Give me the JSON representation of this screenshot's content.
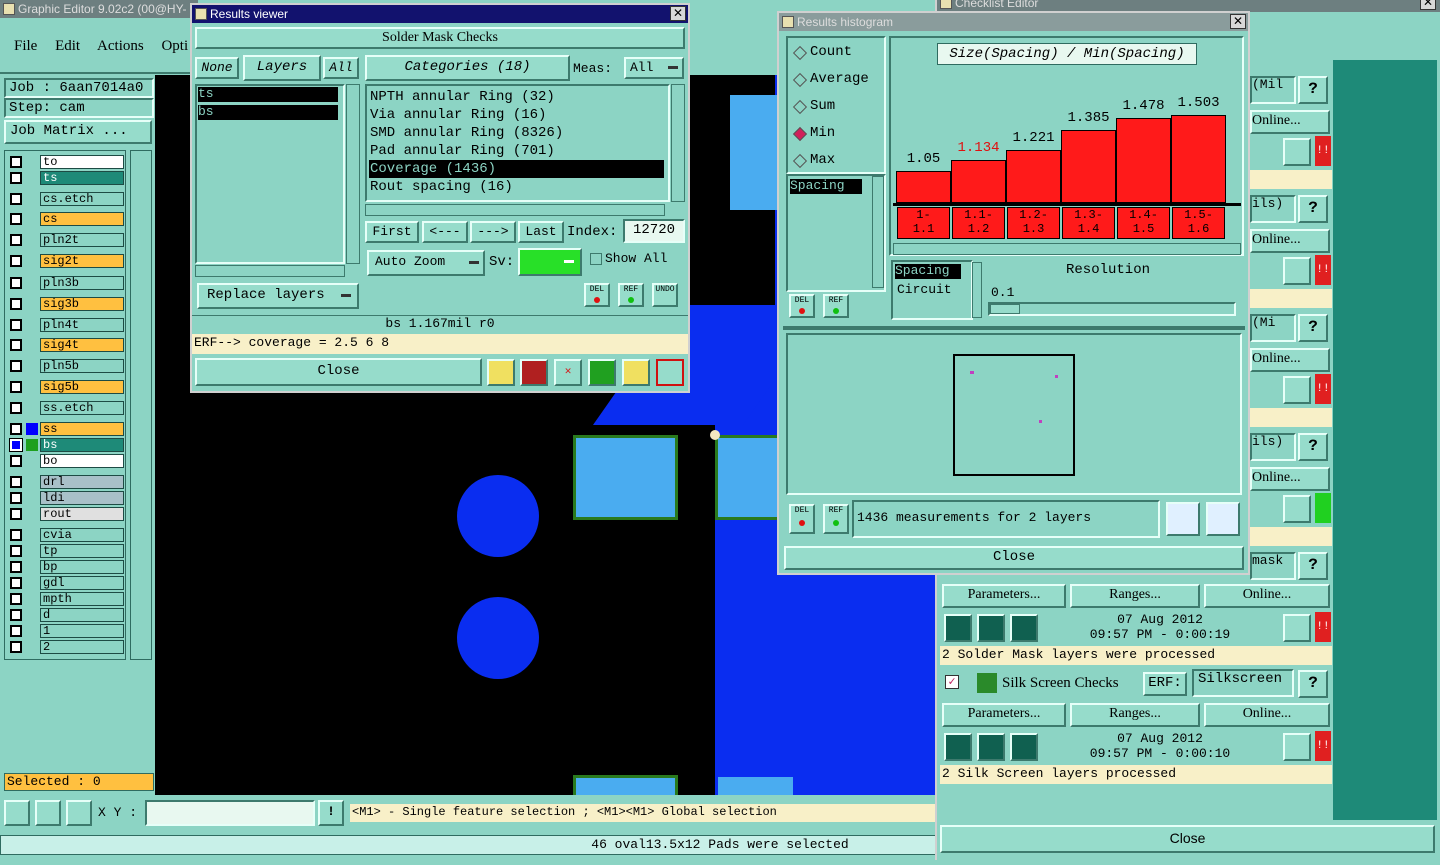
{
  "main_window": {
    "title": "Graphic Editor 9.02c2 (00@HY-",
    "menu": [
      "File",
      "Edit",
      "Actions",
      "Opti"
    ],
    "job_label": "Job : 6aan7014a0",
    "step_label": "Step: cam",
    "job_matrix": "Job Matrix ...",
    "selected": "Selected : 0",
    "xy_label": "X Y :",
    "help_text": "<M1> - Single feature selection ; <M1><M1> Global selection",
    "status": "46 oval13.5x12 Pads were selected",
    "layers": [
      {
        "name": "to",
        "color": "#ffffff"
      },
      {
        "name": "ts",
        "color": "#1e8a78"
      },
      {
        "name": "cs.etch",
        "color": "#8cd4c4"
      },
      {
        "name": "cs",
        "color": "#ffc040"
      },
      {
        "name": "pln2t",
        "color": "#8cd4c4"
      },
      {
        "name": "sig2t",
        "color": "#ffc040"
      },
      {
        "name": "pln3b",
        "color": "#8cd4c4"
      },
      {
        "name": "sig3b",
        "color": "#ffc040"
      },
      {
        "name": "pln4t",
        "color": "#8cd4c4"
      },
      {
        "name": "sig4t",
        "color": "#ffc040"
      },
      {
        "name": "pln5b",
        "color": "#8cd4c4"
      },
      {
        "name": "sig5b",
        "color": "#ffc040"
      },
      {
        "name": "ss.etch",
        "color": "#8cd4c4"
      },
      {
        "name": "ss",
        "color": "#ffc040"
      },
      {
        "name": "bs",
        "color": "#1e8a78"
      },
      {
        "name": "bo",
        "color": "#ffffff"
      },
      {
        "name": "drl",
        "color": "#a8c0c8"
      },
      {
        "name": "ldi",
        "color": "#a8c0c8"
      },
      {
        "name": "rout",
        "color": "#e0e0e0"
      },
      {
        "name": "cvia",
        "color": "#8cd4c4"
      },
      {
        "name": "tp",
        "color": "#8cd4c4"
      },
      {
        "name": "bp",
        "color": "#8cd4c4"
      },
      {
        "name": "gdl",
        "color": "#8cd4c4"
      },
      {
        "name": "mpth",
        "color": "#8cd4c4"
      },
      {
        "name": "d",
        "color": "#8cd4c4"
      },
      {
        "name": "1",
        "color": "#8cd4c4"
      },
      {
        "name": "2",
        "color": "#8cd4c4"
      }
    ]
  },
  "results_viewer": {
    "title": "Results viewer",
    "header": "Solder Mask Checks",
    "none": "None",
    "layers": "Layers",
    "all": "All",
    "categories": "Categories (18)",
    "meas_label": "Meas:",
    "meas_value": "All",
    "layer_items": [
      "ts",
      "bs"
    ],
    "category_items": [
      "NPTH annular Ring (32)",
      "Via annular Ring (16)",
      "SMD annular Ring (8326)",
      "Pad annular Ring (701)",
      "Coverage (1436)",
      "Rout spacing (16)"
    ],
    "first": "First",
    "prev": "<---",
    "next": "--->",
    "last": "Last",
    "index_label": "Index:",
    "index_value": "12720",
    "auto_zoom": "Auto Zoom",
    "sv_label": "Sv:",
    "show_all": "Show All",
    "replace_layers": "Replace layers",
    "info": "bs 1.167mil  r0",
    "erf": "ERF--> coverage = 2.5 6 8",
    "close": "Close",
    "del": "DEL",
    "ref": "REF",
    "undo": "UNDO"
  },
  "histogram": {
    "title": "Results histogram",
    "modes": [
      "Count",
      "Average",
      "Sum",
      "Min",
      "Max"
    ],
    "selected_mode": "Min",
    "chart_title": "Size(Spacing) / Min(Spacing)",
    "values": [
      "1.05",
      "1.134",
      "1.221",
      "1.385",
      "1.478",
      "1.503"
    ],
    "bins": [
      "1-\n1.1",
      "1.1-\n1.2",
      "1.2-\n1.3",
      "1.3-\n1.4",
      "1.4-\n1.5",
      "1.5-\n1.6"
    ],
    "list_item": "Spacing",
    "type_items": [
      "Spacing",
      "Circuit"
    ],
    "resolution_label": "Resolution",
    "resolution_value": "0.1",
    "measurements": "1436 measurements for 2 layers",
    "close": "Close"
  },
  "checklist": {
    "title": "Checklist Editor",
    "row_frag": [
      "(Mil",
      "ils)",
      "(Mi",
      "ils)",
      "mask"
    ],
    "online": "Online...",
    "parameters": "Parameters...",
    "ranges": "Ranges...",
    "stamp1_date": "07 Aug 2012",
    "stamp1_time": "09:57 PM - 0:00:19",
    "stamp1_msg": "2 Solder Mask layers were processed",
    "silk_name": "Silk Screen Checks",
    "erf_label": "ERF:",
    "erf_value": "Silkscreen",
    "stamp2_date": "07 Aug 2012",
    "stamp2_time": "09:57 PM - 0:00:10",
    "stamp2_msg": "2 Silk Screen layers processed",
    "close": "Close",
    "q": "?"
  }
}
